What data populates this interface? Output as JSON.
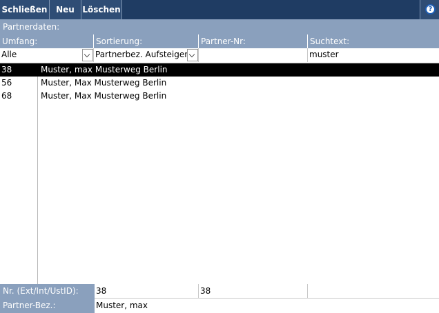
{
  "toolbar": {
    "close_label": "Schließen",
    "new_label": "Neu",
    "delete_label": "Löschen",
    "help_label": "?"
  },
  "section": {
    "title": "Partnerdaten:"
  },
  "filters": {
    "umfang_label": "Umfang:",
    "umfang_value": "Alle",
    "sort_label": "Sortierung:",
    "sort_value": "Partnerbez. Aufsteigend",
    "partner_nr_label": "Partner-Nr:",
    "partner_nr_value": "",
    "search_label": "Suchtext:",
    "search_value": "muster"
  },
  "list": {
    "rows": [
      {
        "id": "38",
        "text": "Muster, max Musterweg Berlin",
        "selected": true
      },
      {
        "id": "56",
        "text": "Muster, Max Musterweg Berlin",
        "selected": false
      },
      {
        "id": "68",
        "text": "Muster, Max Musterweg Berlin",
        "selected": false
      }
    ]
  },
  "details": {
    "nr_label": "Nr. (Ext/Int/UstID):",
    "nr_ext": "38",
    "nr_int": "38",
    "nr_ustid": "",
    "bez_label": "Partner-Bez.:",
    "bez_value": "Muster, max"
  }
}
